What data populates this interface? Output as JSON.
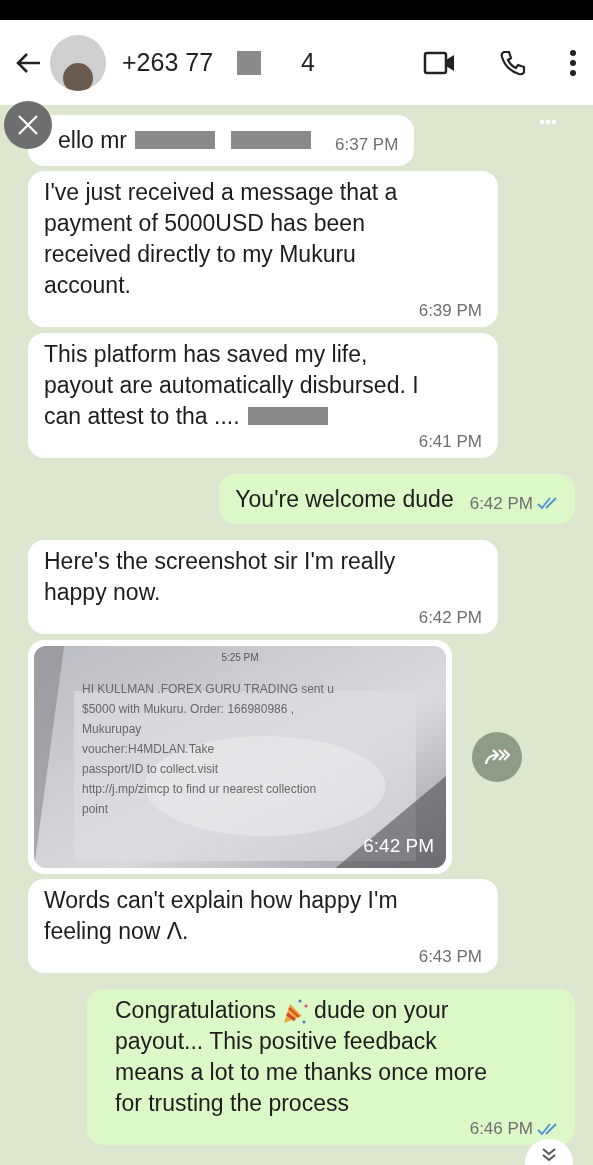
{
  "header": {
    "name_start": "+263 77",
    "name_end": "4"
  },
  "messages": [
    {
      "kind": "short",
      "outgoing": false,
      "lines": [
        [
          {
            "kind": "text",
            "text": "ello mr"
          },
          {
            "kind": "redaction"
          },
          {
            "kind": "redaction"
          }
        ]
      ],
      "time": "6:37 PM"
    },
    {
      "kind": "text",
      "outgoing": false,
      "lines": [
        [
          {
            "kind": "text",
            "text": "I've just received a message that a"
          }
        ],
        [
          {
            "kind": "text",
            "text": "payment of 5000USD has been"
          }
        ],
        [
          {
            "kind": "text",
            "text": "received directly to my Mukuru"
          }
        ],
        [
          {
            "kind": "text",
            "text": "account."
          }
        ]
      ],
      "time": "6:39 PM"
    },
    {
      "kind": "text",
      "outgoing": false,
      "lines": [
        [
          {
            "kind": "text",
            "text": "This platform has saved my life,"
          }
        ],
        [
          {
            "kind": "text",
            "text": "payout are automatically disbursed. I"
          }
        ],
        [
          {
            "kind": "text",
            "text": "can attest to tha ...."
          },
          {
            "kind": "redaction"
          }
        ]
      ],
      "time": "6:41 PM"
    },
    {
      "kind": "short",
      "outgoing": true,
      "read": true,
      "lines": [
        [
          {
            "kind": "text",
            "text": "You're welcome dude"
          }
        ]
      ],
      "time": "6:42 PM"
    },
    {
      "kind": "text",
      "outgoing": false,
      "lines": [
        [
          {
            "kind": "text",
            "text": "Here's the screenshot sir I'm really"
          }
        ],
        [
          {
            "kind": "text",
            "text": "happy now."
          }
        ]
      ],
      "time": "6:42 PM"
    },
    {
      "outgoing": false,
      "image_time": "5:25 PM",
      "lines": [
        "HI  KULLMAN .FOREX GURU TRADING sent u",
        "$5000 with Mukuru. Order: 166980986 ,",
        "Mukurupay",
        "voucher:H4MDLAN.Take",
        "passport/ID to collect.visit",
        "http://j.mp/zimcp to find ur nearest collection",
        "point"
      ],
      "time": "6:42 PM"
    },
    {
      "kind": "text",
      "outgoing": false,
      "lines": [
        [
          {
            "kind": "text",
            "text": "Words can't explain how happy I'm"
          }
        ],
        [
          {
            "kind": "text",
            "text": "feeling now Λ."
          }
        ]
      ],
      "time": "6:43 PM"
    },
    {
      "kind": "text",
      "outgoing": true,
      "read": true,
      "lines": [
        [
          {
            "kind": "text",
            "text": "Congratulations"
          },
          {
            "kind": "emoji"
          },
          {
            "kind": "text",
            "text": "dude on your"
          }
        ],
        [
          {
            "kind": "text",
            "text": "payout... This positive feedback"
          }
        ],
        [
          {
            "kind": "text",
            "text": "means a lot to me thanks once more"
          }
        ],
        [
          {
            "kind": "text",
            "text": "for trusting the process"
          }
        ]
      ],
      "time": "6:46 PM"
    }
  ]
}
